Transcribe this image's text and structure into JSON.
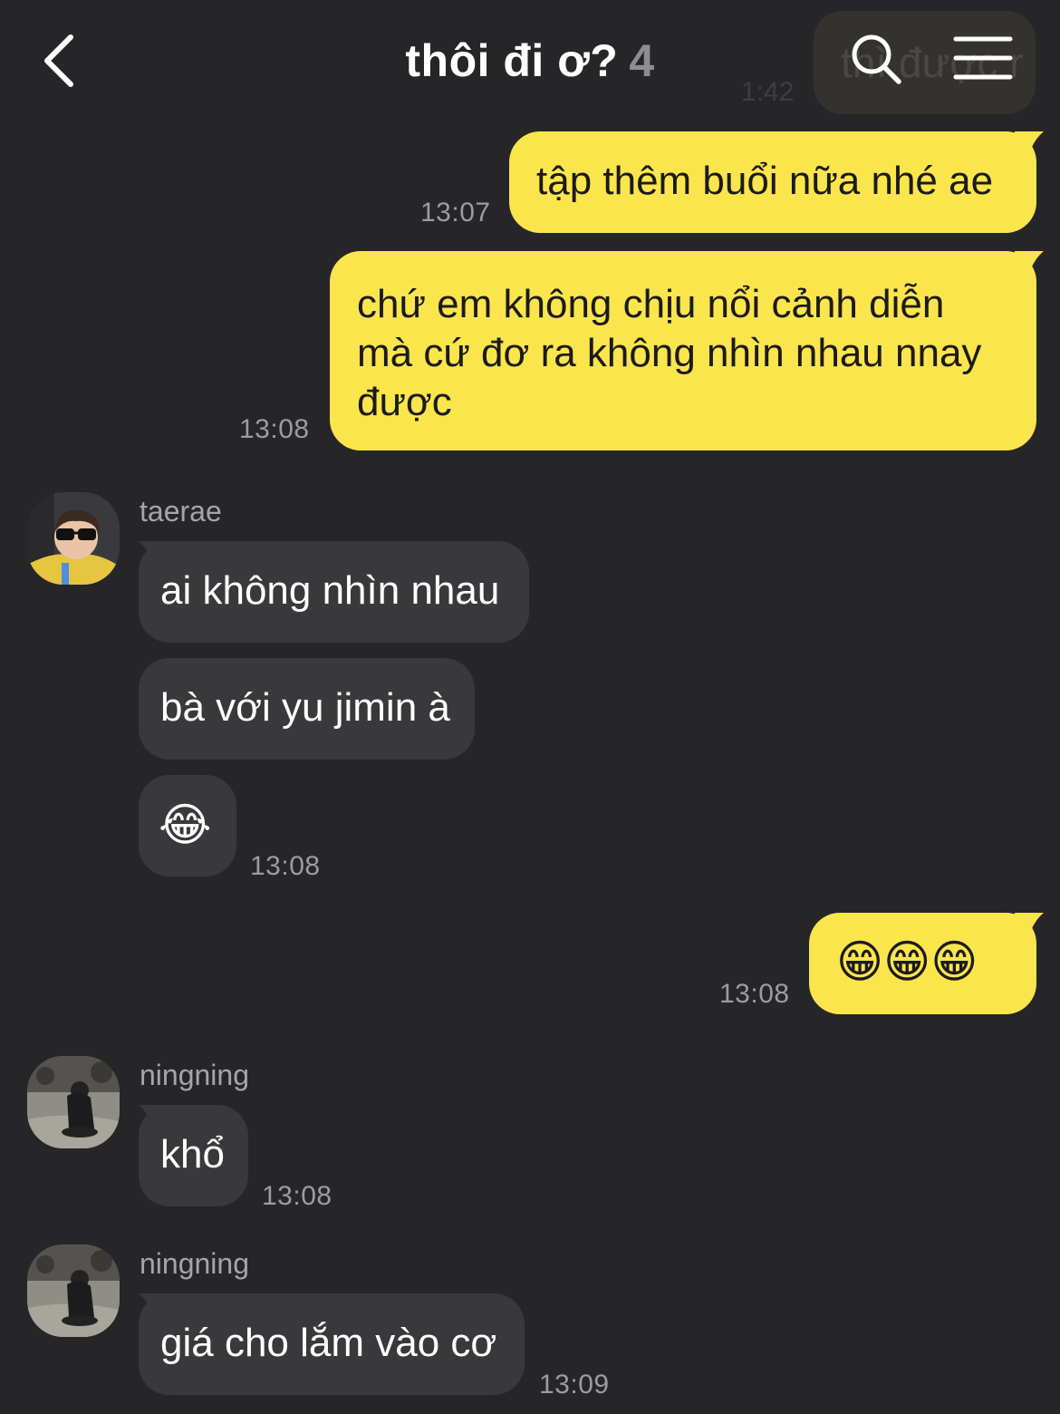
{
  "header": {
    "title": "thôi đi ơ?",
    "member_count": "4",
    "ghost_text": "thì được r",
    "ghost_time": "1:42"
  },
  "messages": [
    {
      "from": "me",
      "text": "tập thêm buổi nữa nhé ae",
      "time": "13:07"
    },
    {
      "from": "me",
      "lines": [
        "chứ em không chịu nổi cảnh diễn",
        "mà cứ đơ ra không nhìn nhau nnay",
        "được"
      ],
      "time": "13:08"
    },
    {
      "from": "taerae",
      "sender": "taerae",
      "texts": [
        "ai không nhìn nhau",
        "bà với yu jimin à",
        "😂"
      ],
      "time": "13:08"
    },
    {
      "from": "me",
      "text": "😁😁😁",
      "time": "13:08"
    },
    {
      "from": "ningning",
      "sender": "ningning",
      "text": "khổ",
      "time": "13:08"
    },
    {
      "from": "ningning",
      "sender": "ningning",
      "text": "giá cho lắm vào cơ",
      "time": "13:09"
    }
  ],
  "icons": {
    "back": "chevron-left-icon",
    "search": "search-icon",
    "menu": "hamburger-menu-icon"
  },
  "colors": {
    "background": "#262629",
    "my_bubble": "#fbe54d",
    "their_bubble": "#39393c",
    "timestamp": "#9c9ca0"
  }
}
